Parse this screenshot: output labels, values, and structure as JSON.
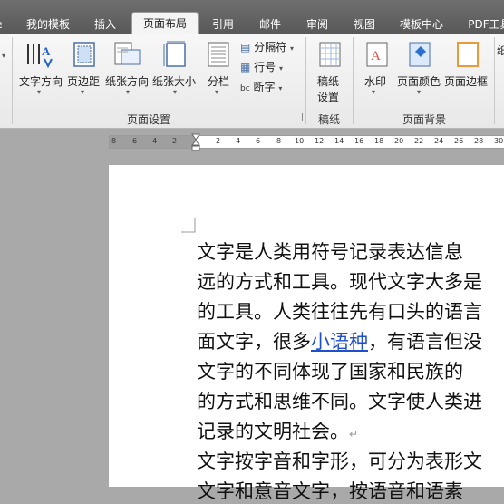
{
  "tabs": [
    {
      "label": "我的模板",
      "active": false
    },
    {
      "label": "插入",
      "active": false
    },
    {
      "label": "页面布局",
      "active": true
    },
    {
      "label": "引用",
      "active": false
    },
    {
      "label": "邮件",
      "active": false
    },
    {
      "label": "审阅",
      "active": false
    },
    {
      "label": "视图",
      "active": false
    },
    {
      "label": "模板中心",
      "active": false
    },
    {
      "label": "PDF工具",
      "active": false
    }
  ],
  "ribbon": {
    "text_direction": "文字方向",
    "margins": "页边距",
    "orientation": "纸张方向",
    "size": "纸张大小",
    "columns": "分栏",
    "breaks": "分隔符",
    "line_numbers": "行号",
    "hyphenation": "断字",
    "draft_paper_line1": "稿纸",
    "draft_paper_line2": "设置",
    "watermark": "水印",
    "page_color": "页面颜色",
    "page_border": "页面边框",
    "group_page_setup": "页面设置",
    "group_draft": "稿纸",
    "group_background": "页面背景",
    "right_partial": "纸"
  },
  "ruler": {
    "ticks": [
      "8",
      "6",
      "4",
      "2",
      "2",
      "4",
      "6",
      "8",
      "10",
      "12",
      "14",
      "16",
      "18",
      "20",
      "22",
      "24",
      "26",
      "28",
      "30"
    ]
  },
  "document": {
    "lines": [
      "文字是人类用符号记录表达信息",
      "远的方式和工具。现代文字大多是",
      "的工具。人类往往先有口头的语言",
      "面文字，很多",
      "文字的不同体现了国家和民族的",
      "的方式和思维不同。文字使人类进",
      "记录的文明社会。",
      "文字按字音和字形，可分为表形文",
      "文字和意音文字，按语音和语素"
    ],
    "link": "小语种",
    "line4_after": "，有语言但没"
  },
  "colors": {
    "tabbar": "#5e5e5e",
    "link": "#1f4fcc"
  }
}
